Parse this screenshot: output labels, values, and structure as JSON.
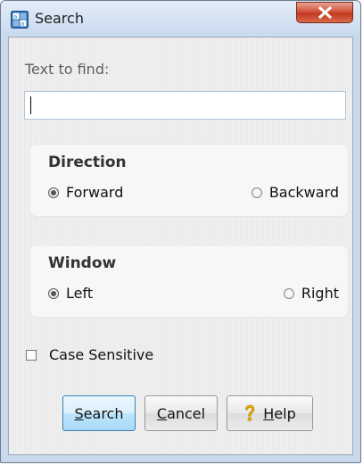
{
  "window": {
    "title": "Search",
    "icon": "search-app-icon",
    "close_icon": "close-icon",
    "close_color": "#c2381f"
  },
  "find": {
    "label": "Text to find:",
    "value": "",
    "placeholder": ""
  },
  "direction": {
    "title": "Direction",
    "options": [
      {
        "label": "Forward",
        "checked": true
      },
      {
        "label": "Backward",
        "checked": false
      }
    ]
  },
  "window_group": {
    "title": "Window",
    "options": [
      {
        "label": "Left",
        "checked": true
      },
      {
        "label": "Right",
        "checked": false
      }
    ]
  },
  "case_sensitive": {
    "label": "Case Sensitive",
    "checked": false
  },
  "buttons": {
    "search": {
      "mnemonic": "S",
      "rest": "earch"
    },
    "cancel": {
      "mnemonic": "C",
      "rest": "ancel"
    },
    "help": {
      "mnemonic": "H",
      "rest": "elp",
      "icon": "question-mark-icon"
    }
  },
  "colors": {
    "default_button": "#bee6fd",
    "help_icon": "#f5b800"
  }
}
